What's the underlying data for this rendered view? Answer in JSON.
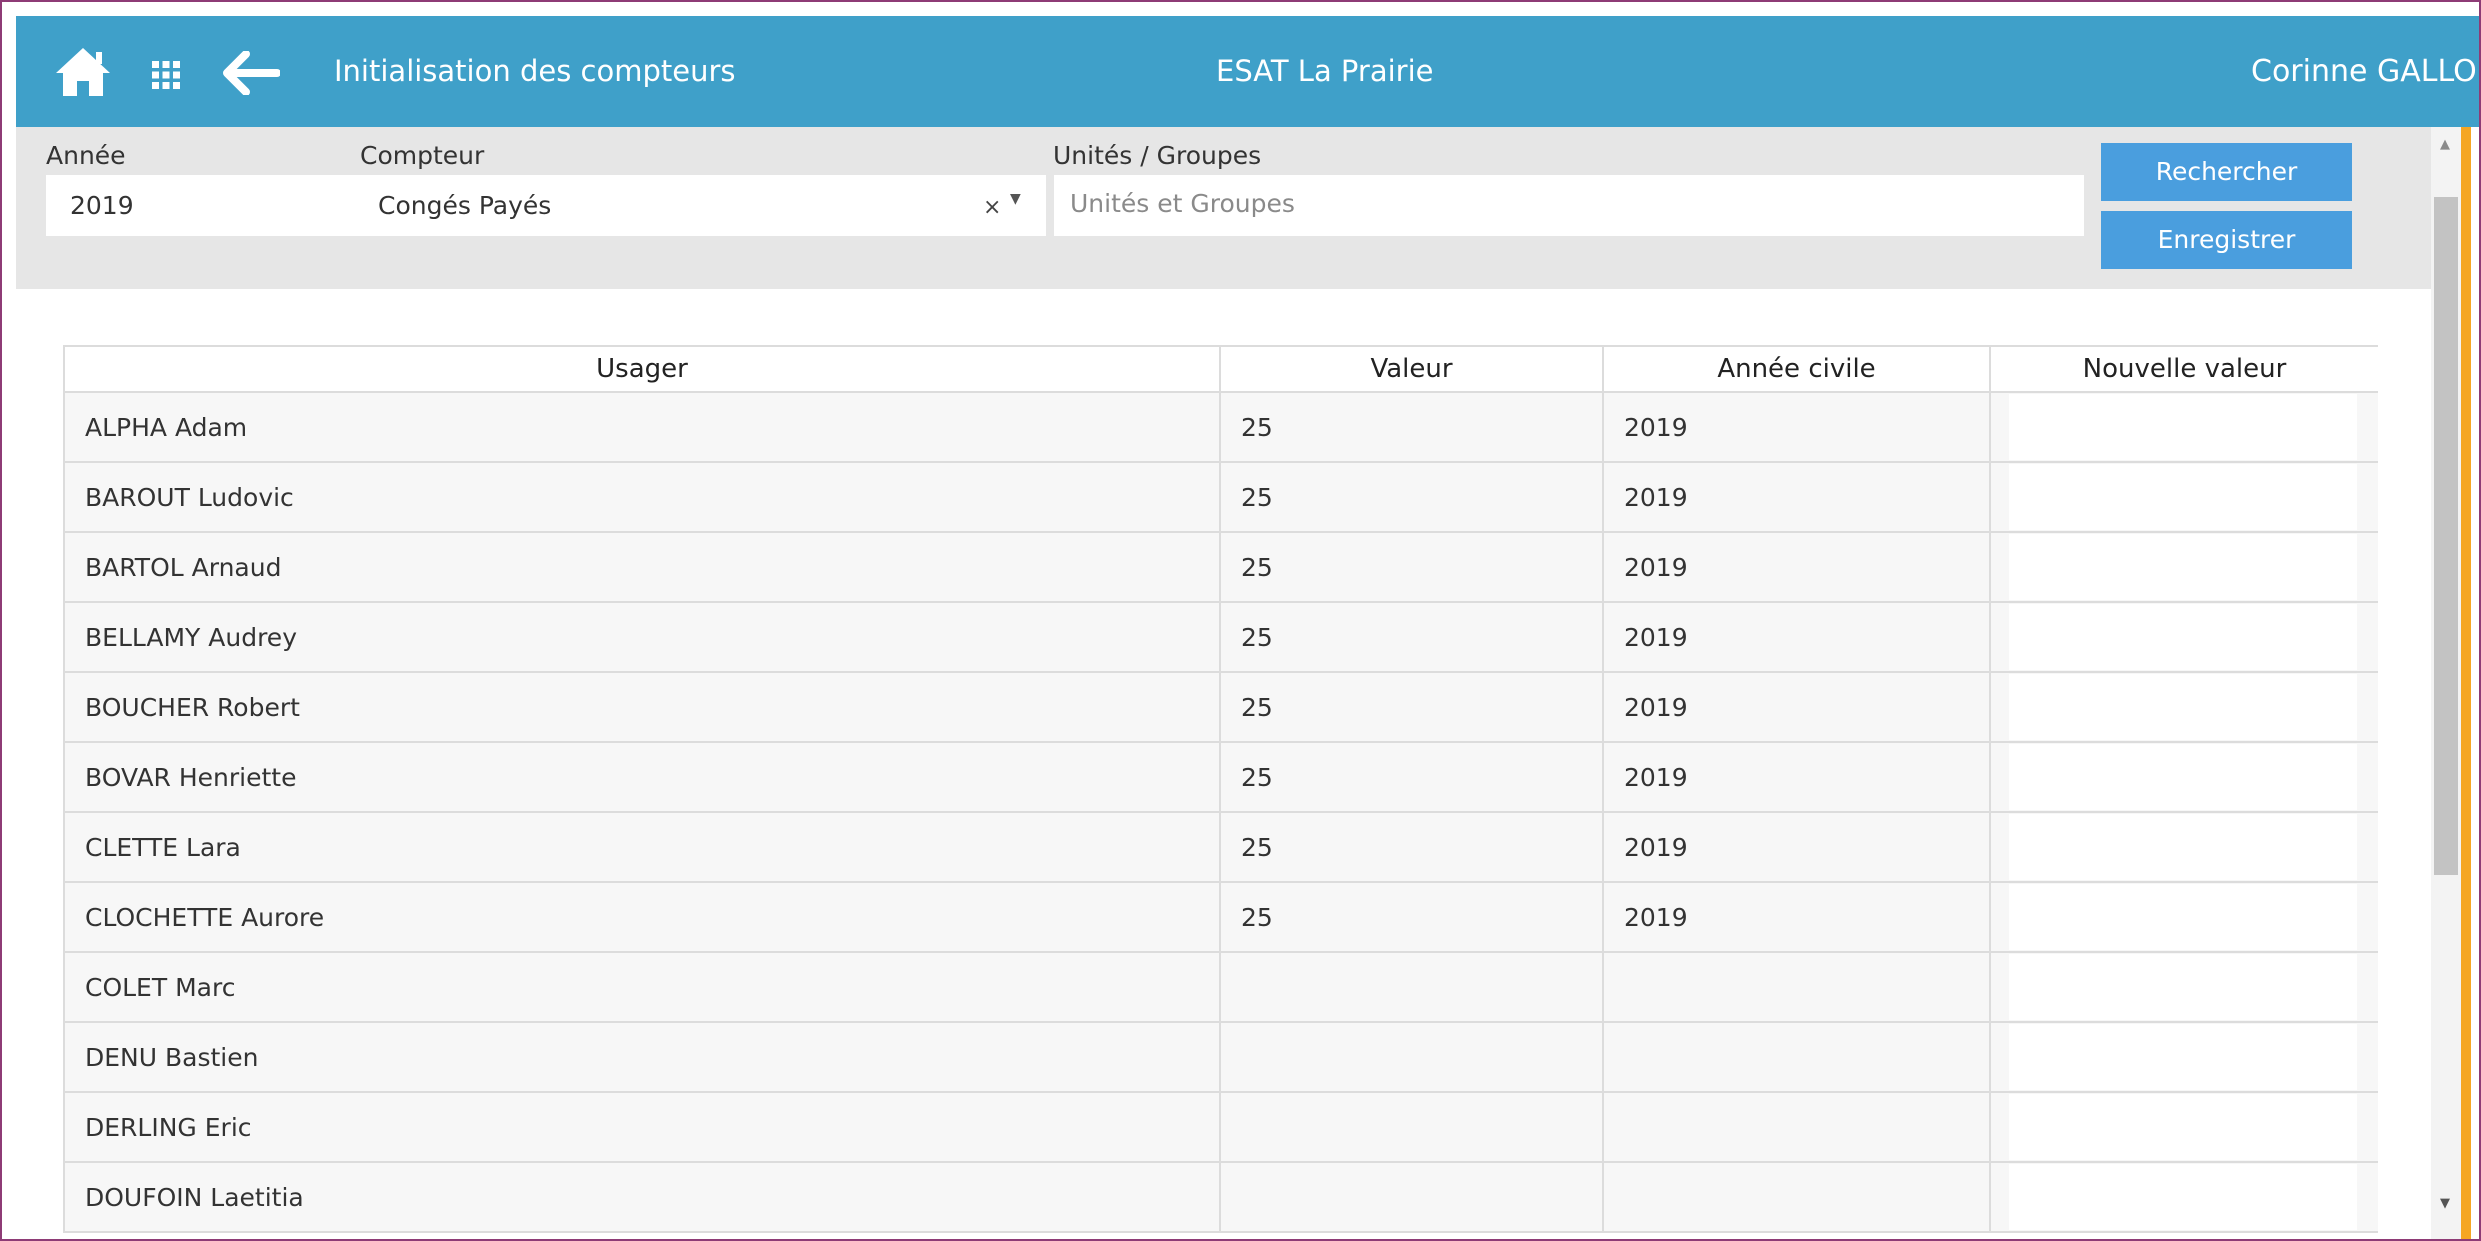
{
  "header": {
    "title": "Initialisation des compteurs",
    "organization": "ESAT La Prairie",
    "user": "Corinne GALLOF",
    "icons": [
      "home-icon",
      "apps-grid-icon",
      "back-arrow-icon"
    ]
  },
  "filters": {
    "year_label": "Année",
    "year_value": "2019",
    "counter_label": "Compteur",
    "counter_value": "Congés Payés",
    "counter_clear": "×",
    "counter_caret": "▼",
    "units_label": "Unités / Groupes",
    "units_placeholder": "Unités et Groupes",
    "search_button": "Rechercher",
    "save_button": "Enregistrer"
  },
  "scrollbar": {
    "up_arrow": "▲",
    "down_arrow": "▼"
  },
  "table": {
    "columns": [
      "Usager",
      "Valeur",
      "Année civile",
      "Nouvelle valeur"
    ],
    "rows": [
      {
        "usager": "ALPHA Adam",
        "valeur": "25",
        "annee": "2019",
        "nouvelle": ""
      },
      {
        "usager": "BAROUT Ludovic",
        "valeur": "25",
        "annee": "2019",
        "nouvelle": ""
      },
      {
        "usager": "BARTOL Arnaud",
        "valeur": "25",
        "annee": "2019",
        "nouvelle": ""
      },
      {
        "usager": "BELLAMY Audrey",
        "valeur": "25",
        "annee": "2019",
        "nouvelle": ""
      },
      {
        "usager": "BOUCHER Robert",
        "valeur": "25",
        "annee": "2019",
        "nouvelle": ""
      },
      {
        "usager": "BOVAR Henriette",
        "valeur": "25",
        "annee": "2019",
        "nouvelle": ""
      },
      {
        "usager": "CLETTE Lara",
        "valeur": "25",
        "annee": "2019",
        "nouvelle": ""
      },
      {
        "usager": "CLOCHETTE Aurore",
        "valeur": "25",
        "annee": "2019",
        "nouvelle": ""
      },
      {
        "usager": "COLET Marc",
        "valeur": "",
        "annee": "",
        "nouvelle": ""
      },
      {
        "usager": "DENU Bastien",
        "valeur": "",
        "annee": "",
        "nouvelle": ""
      },
      {
        "usager": "DERLING Eric",
        "valeur": "",
        "annee": "",
        "nouvelle": ""
      },
      {
        "usager": "DOUFOIN Laetitia",
        "valeur": "",
        "annee": "",
        "nouvelle": ""
      }
    ]
  },
  "colors": {
    "header_bg": "#3fa0c9",
    "button_bg": "#4a9ede",
    "filter_bg": "#e6e6e6",
    "frame_border": "#8e3b76",
    "accent_edge": "#f5a623"
  }
}
